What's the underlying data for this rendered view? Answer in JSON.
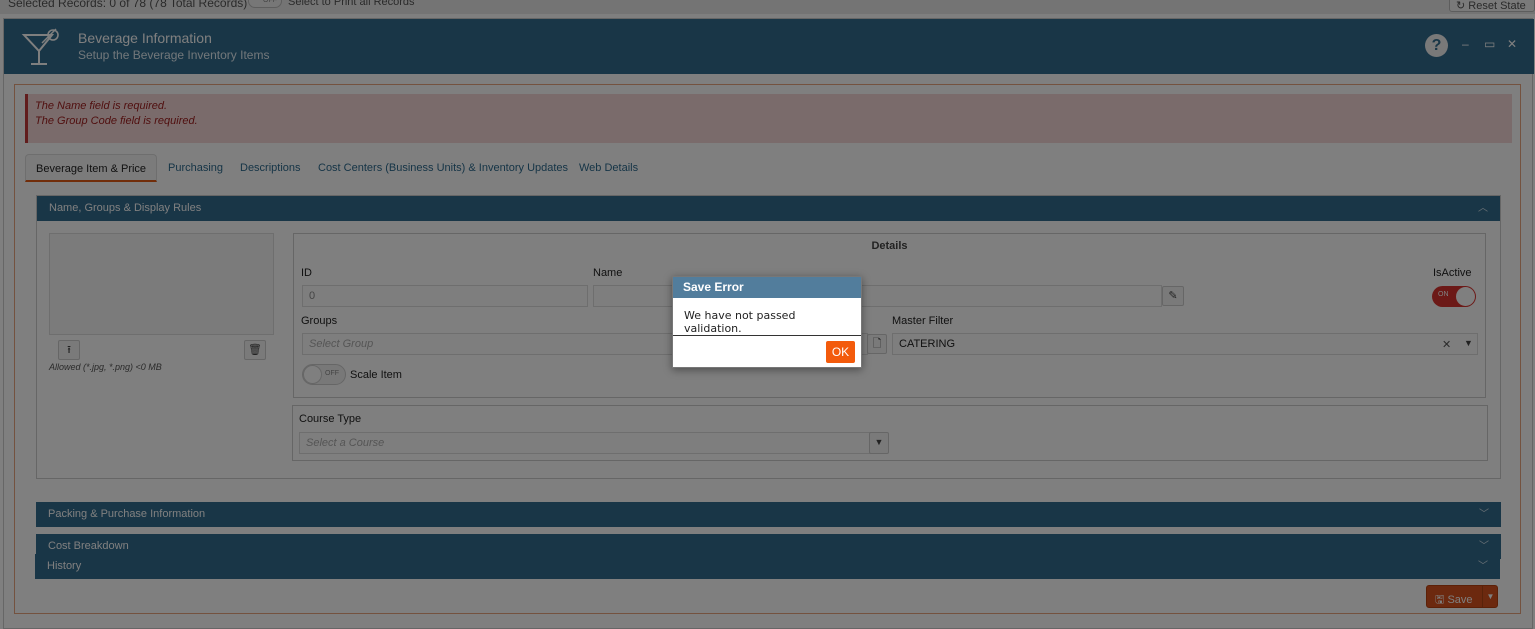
{
  "topbar": {
    "selected": "Selected Records: 0 of 78 (78 Total Records)",
    "toggle_text": "OFF",
    "print_label": "Select to Print all Records",
    "reset_label": "Reset State"
  },
  "window": {
    "title": "Beverage Information",
    "subtitle": "Setup the Beverage Inventory Items",
    "help": "?",
    "minimize": "–",
    "maximize": "▭",
    "close": "✕"
  },
  "alert": {
    "line1": "The Name field is required.",
    "line2": "The Group Code field is required."
  },
  "tabs": [
    {
      "label": "Beverage Item & Price"
    },
    {
      "label": "Purchasing"
    },
    {
      "label": "Descriptions"
    },
    {
      "label": "Cost Centers (Business Units) & Inventory Updates"
    },
    {
      "label": "Web Details"
    }
  ],
  "section1": {
    "title": "Name, Groups & Display Rules",
    "allowed": "Allowed (*.jpg, *.png) <0 MB",
    "details": {
      "title": "Details",
      "id_label": "ID",
      "id_value": "0",
      "name_label": "Name",
      "name_value": "",
      "isactive_label": "IsActive",
      "isactive_toggle": "ON",
      "groups_label": "Groups",
      "groups_placeholder": "Select Group",
      "master_filter_label": "Master Filter",
      "master_filter_value": "CATERING",
      "scale_toggle": "OFF",
      "scale_label": "Scale Item"
    },
    "course": {
      "label": "Course Type",
      "placeholder": "Select a Course"
    }
  },
  "sections": {
    "packing": "Packing & Purchase Information",
    "cost": "Cost Breakdown",
    "history": "History"
  },
  "save_label": "Save",
  "dialog": {
    "title": "Save Error",
    "message": "We have not passed validation.",
    "ok": "OK"
  },
  "colors": {
    "header": "#336c8e",
    "accent": "#f35b0c",
    "error_text": "#a12020"
  }
}
